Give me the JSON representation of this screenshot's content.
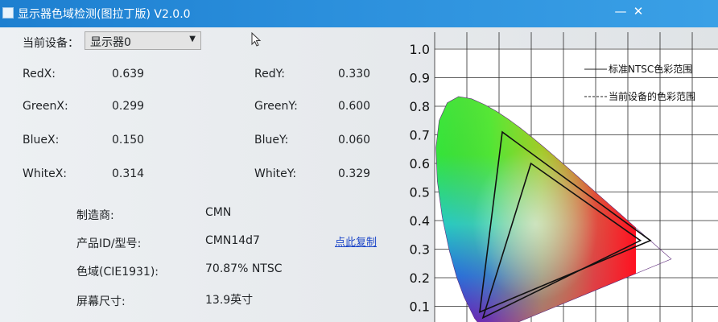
{
  "window": {
    "title": "显示器色域检测(图拉丁版) V2.0.0",
    "minimize_glyph": "—",
    "close_glyph": "✕"
  },
  "device": {
    "label": "当前设备：",
    "selected": "显示器0"
  },
  "coords": {
    "red_x_label": "RedX:",
    "red_x": "0.639",
    "red_y_label": "RedY:",
    "red_y": "0.330",
    "green_x_label": "GreenX:",
    "green_x": "0.299",
    "green_y_label": "GreenY:",
    "green_y": "0.600",
    "blue_x_label": "BlueX:",
    "blue_x": "0.150",
    "blue_y_label": "BlueY:",
    "blue_y": "0.060",
    "white_x_label": "WhiteX:",
    "white_x": "0.314",
    "white_y_label": "WhiteY:",
    "white_y": "0.329"
  },
  "info": {
    "maker_label": "制造商:",
    "maker": "CMN",
    "model_label": "产品ID/型号:",
    "model": "CMN14d7",
    "copy_link": "点此复制",
    "gamut_label": "色域(CIE1931):",
    "gamut": "70.87% NTSC",
    "size_label": "屏幕尺寸:",
    "size": "13.9英寸"
  },
  "chart_data": {
    "type": "line",
    "xlim": [
      0,
      0.8
    ],
    "ylim": [
      0,
      1.0
    ],
    "y_ticks": [
      "0.1",
      "0.2",
      "0.3",
      "0.4",
      "0.5",
      "0.6",
      "0.7",
      "0.8",
      "0.9",
      "1.0"
    ],
    "grid": true,
    "legend_position": "top-right",
    "legend": [
      "标准NTSC色彩范围",
      "当前设备的色彩范围"
    ],
    "series": [
      {
        "name": "标准NTSC色彩范围",
        "points": [
          [
            0.67,
            0.33
          ],
          [
            0.21,
            0.71
          ],
          [
            0.14,
            0.08
          ]
        ]
      },
      {
        "name": "当前设备的色彩范围",
        "points": [
          [
            0.639,
            0.33
          ],
          [
            0.299,
            0.6
          ],
          [
            0.15,
            0.06
          ]
        ]
      }
    ],
    "locus": [
      [
        0.1741,
        0.005
      ],
      [
        0.144,
        0.0297
      ],
      [
        0.1241,
        0.0578
      ],
      [
        0.0913,
        0.1327
      ],
      [
        0.0687,
        0.2007
      ],
      [
        0.0454,
        0.295
      ],
      [
        0.0235,
        0.4127
      ],
      [
        0.0082,
        0.5384
      ],
      [
        0.0039,
        0.6548
      ],
      [
        0.0139,
        0.7502
      ],
      [
        0.0389,
        0.812
      ],
      [
        0.0743,
        0.8338
      ],
      [
        0.1142,
        0.8262
      ],
      [
        0.1547,
        0.8059
      ],
      [
        0.1929,
        0.7816
      ],
      [
        0.2296,
        0.7543
      ],
      [
        0.2658,
        0.7243
      ],
      [
        0.3016,
        0.6923
      ],
      [
        0.3373,
        0.6589
      ],
      [
        0.3731,
        0.6245
      ],
      [
        0.4087,
        0.5896
      ],
      [
        0.4441,
        0.5547
      ],
      [
        0.4788,
        0.5202
      ],
      [
        0.5125,
        0.4866
      ],
      [
        0.5448,
        0.4544
      ],
      [
        0.5752,
        0.4242
      ],
      [
        0.6029,
        0.3965
      ],
      [
        0.627,
        0.3725
      ],
      [
        0.6482,
        0.3514
      ],
      [
        0.6658,
        0.334
      ],
      [
        0.6915,
        0.3083
      ],
      [
        0.7347,
        0.2653
      ]
    ]
  }
}
